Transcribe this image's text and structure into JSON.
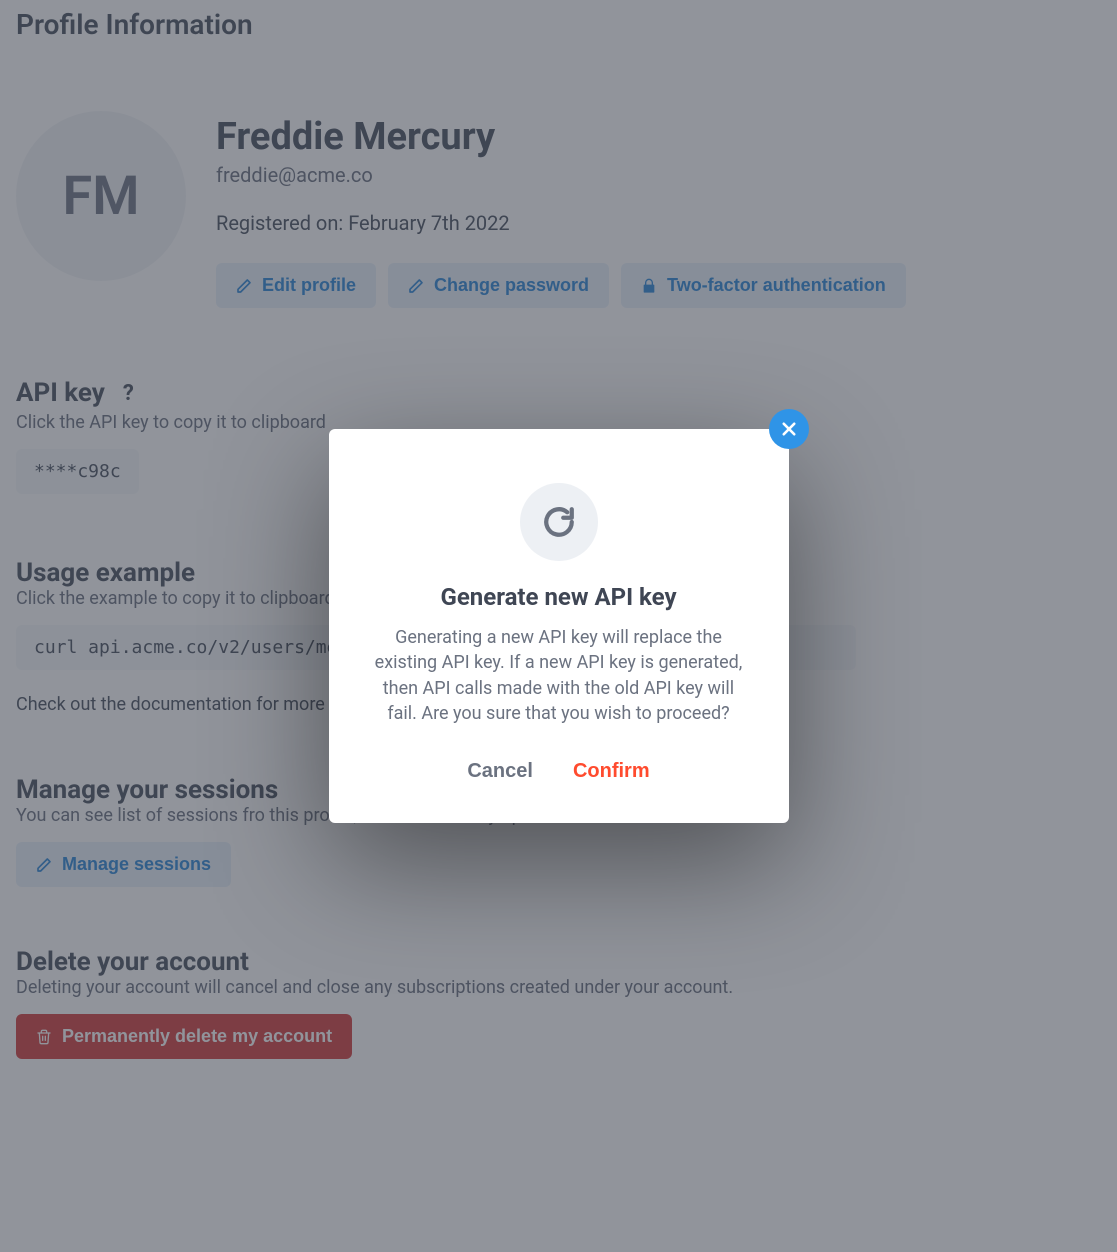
{
  "pageTitle": "Profile Information",
  "avatarInitials": "FM",
  "displayName": "Freddie Mercury",
  "email": "freddie@acme.co",
  "registered": "Registered on: February 7th 2022",
  "actions": {
    "editProfile": "Edit profile",
    "changePassword": "Change password",
    "twoFactor": "Two-factor authentication"
  },
  "apiKey": {
    "title": "API key",
    "help": "?",
    "sub": "Click the API key to copy it to clipboard",
    "masked": "****c98c"
  },
  "usage": {
    "title": "Usage example",
    "sub": "Click the example to copy it to clipboard",
    "code": "curl api.acme.co/v2/users/me",
    "docHint": "Check out the documentation for more"
  },
  "sessions": {
    "title": "Manage your sessions",
    "sub": "You can see list of sessions fro this profile, that are currently opened on different devices",
    "button": "Manage sessions"
  },
  "deleteAccount": {
    "title": "Delete your account",
    "sub": "Deleting your account will cancel and close any subscriptions created under your account.",
    "button": "Permanently delete my account"
  },
  "modal": {
    "title": "Generate new API key",
    "body": "Generating a new API key will replace the existing API key. If a new API key is generated, then API calls made with the old API key will fail. Are you sure that you wish to proceed?",
    "cancel": "Cancel",
    "confirm": "Confirm"
  }
}
